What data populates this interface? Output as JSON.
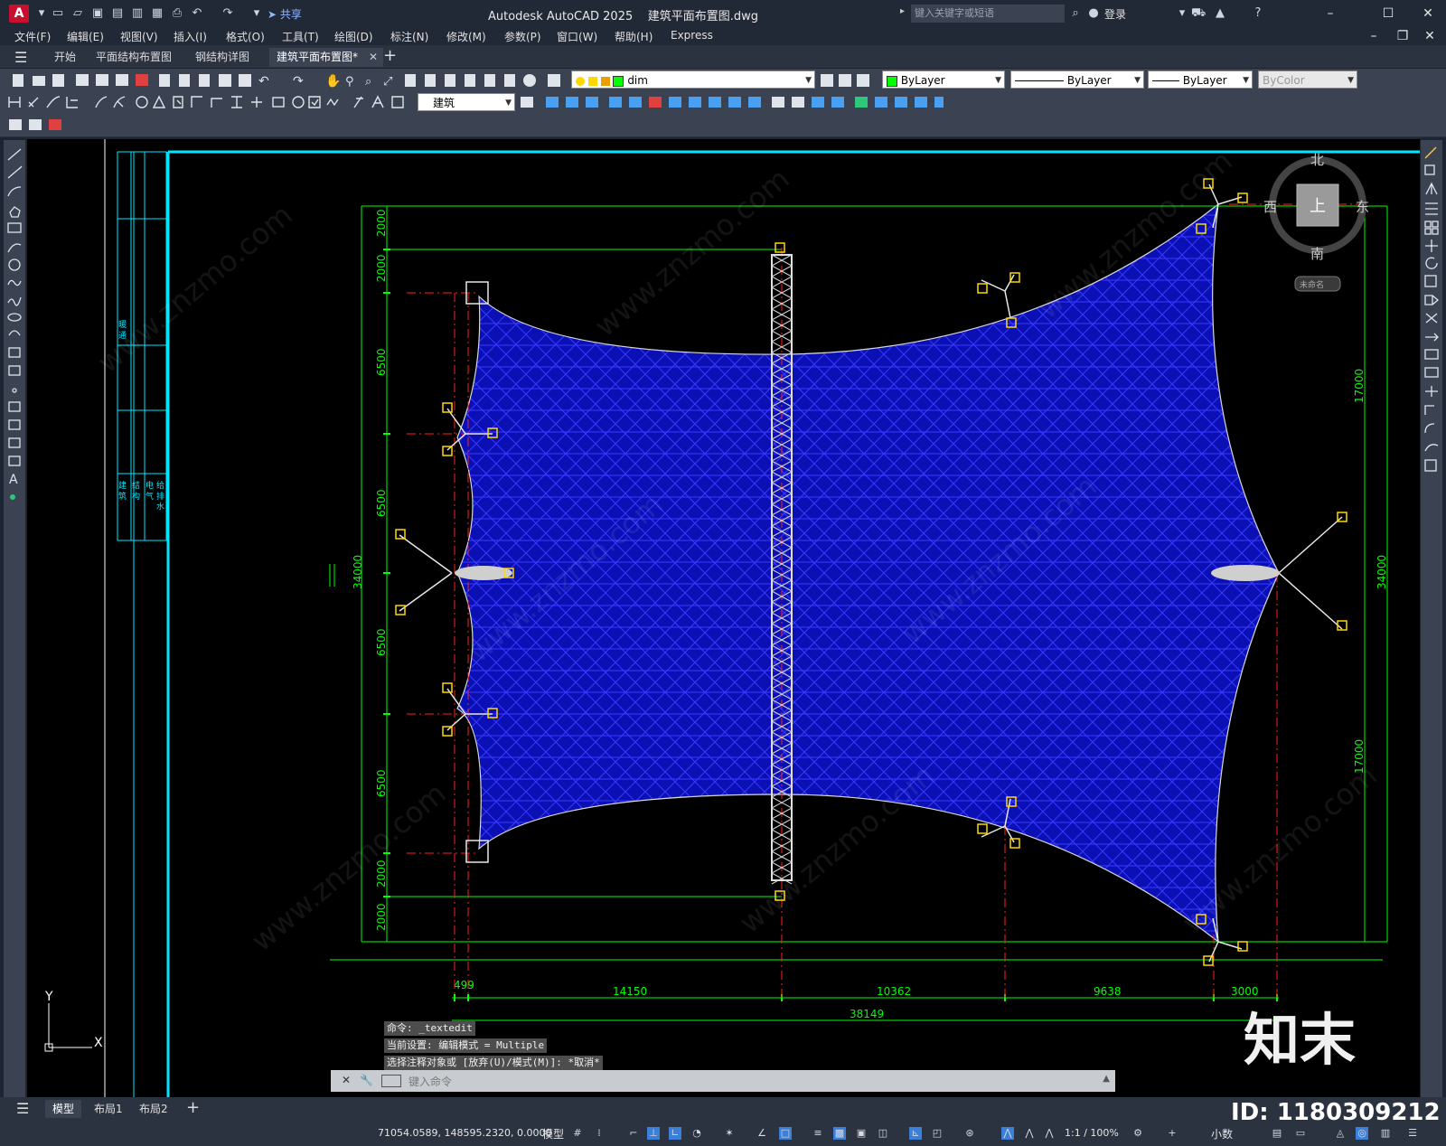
{
  "app": {
    "title": "Autodesk AutoCAD 2025",
    "filename": "建筑平面布置图.dwg",
    "logo": "A",
    "share_label": "共享",
    "search_placeholder": "键入关键字或短语",
    "login_label": "登录"
  },
  "menu": [
    "文件(F)",
    "编辑(E)",
    "视图(V)",
    "插入(I)",
    "格式(O)",
    "工具(T)",
    "绘图(D)",
    "标注(N)",
    "修改(M)",
    "参数(P)",
    "窗口(W)",
    "帮助(H)",
    "Express"
  ],
  "file_tabs": [
    {
      "label": "开始",
      "active": false
    },
    {
      "label": "平面结构布置图",
      "active": false
    },
    {
      "label": "钢结构详图",
      "active": false
    },
    {
      "label": "建筑平面布置图*",
      "active": true
    }
  ],
  "properties": {
    "layer": "dim",
    "color": "ByLayer",
    "linetype": "ByLayer",
    "lineweight": "ByLayer",
    "plotstyle": "ByColor",
    "dimstyle": "建筑"
  },
  "viewcube": {
    "north": "北",
    "south": "南",
    "east": "东",
    "west": "西",
    "top": "上",
    "ucs_label": "未命名"
  },
  "drawing": {
    "left_dims": [
      "2000",
      "2000",
      "6500",
      "6500",
      "34000",
      "6500",
      "6500",
      "2000",
      "2000"
    ],
    "right_dims": [
      "17000",
      "34000",
      "17000"
    ],
    "bottom_dims": [
      "499",
      "14150",
      "10362",
      "9638",
      "3000"
    ],
    "total_width": "38149",
    "title_block": [
      "建 筑",
      "结 构",
      "电 气",
      "给 排 水",
      "暖 通"
    ],
    "colors": {
      "membrane": "#0a10c8",
      "grid": "#3a3aff",
      "dim": "#00ff00",
      "axis": "#ff0000",
      "frame": "#00e5ff",
      "edge": "#d8d8d8"
    }
  },
  "command": {
    "history": [
      "命令: _textedit",
      "当前设置: 编辑模式 = Multiple",
      "选择注释对象或 [放弃(U)/模式(M)]: *取消*"
    ],
    "placeholder": "键入命令"
  },
  "layout_tabs": [
    {
      "label": "模型",
      "active": true
    },
    {
      "label": "布局1",
      "active": false
    },
    {
      "label": "布局2",
      "active": false
    }
  ],
  "status": {
    "coords": "71054.0589, 148595.2320, 0.0000",
    "space": "模型",
    "scale": "1:1 / 100%",
    "units": "小数"
  },
  "watermark": {
    "logo": "知末",
    "id": "ID: 1180309212",
    "url": "www.znzmo.com"
  }
}
